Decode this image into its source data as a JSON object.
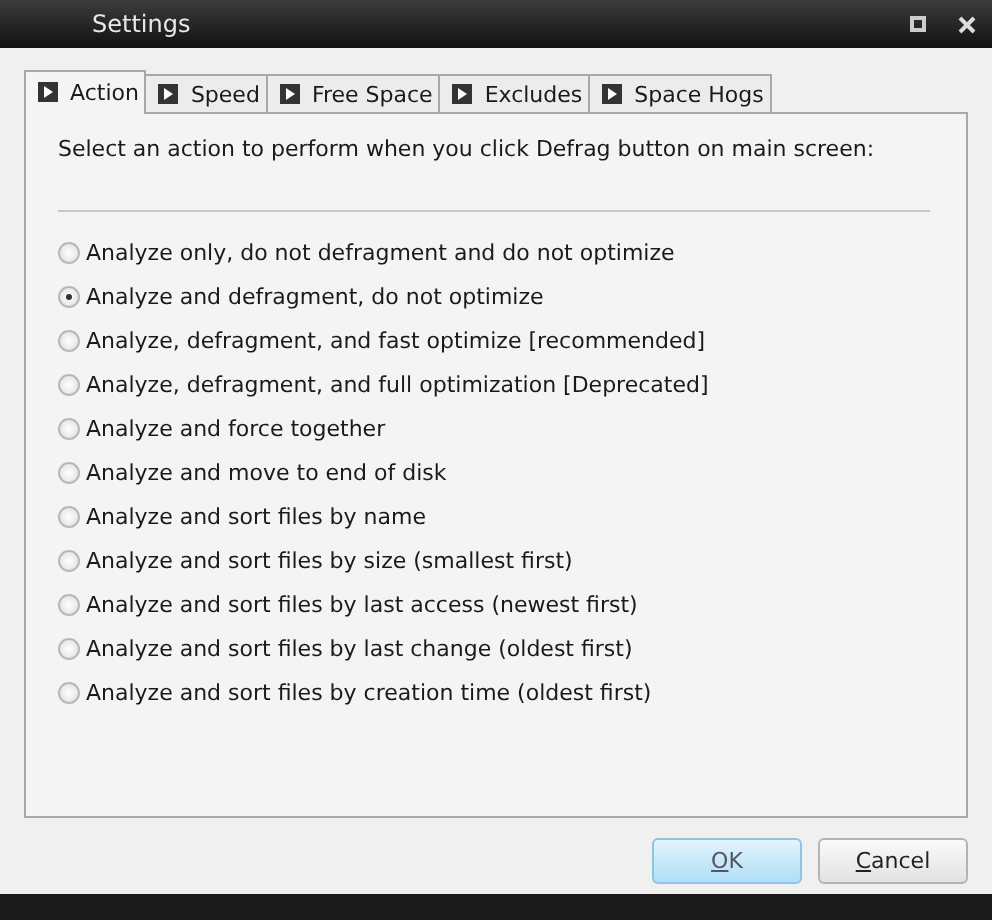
{
  "window": {
    "title": "Settings"
  },
  "tabs": [
    {
      "label": "Action",
      "selected": true
    },
    {
      "label": "Speed",
      "selected": false
    },
    {
      "label": "Free Space",
      "selected": false
    },
    {
      "label": "Excludes",
      "selected": false
    },
    {
      "label": "Space Hogs",
      "selected": false
    }
  ],
  "instruction": "Select an action to perform when you click Defrag button on main screen:",
  "options": [
    {
      "label": "Analyze only, do not defragment and do not optimize",
      "selected": false
    },
    {
      "label": "Analyze and defragment, do not optimize",
      "selected": true
    },
    {
      "label": "Analyze, defragment, and fast optimize [recommended]",
      "selected": false
    },
    {
      "label": "Analyze, defragment, and full optimization [Deprecated]",
      "selected": false
    },
    {
      "label": "Analyze and force together",
      "selected": false
    },
    {
      "label": "Analyze and move to end of disk",
      "selected": false
    },
    {
      "label": "Analyze and sort files by name",
      "selected": false
    },
    {
      "label": "Analyze and sort files by size (smallest first)",
      "selected": false
    },
    {
      "label": "Analyze and sort files by last access (newest first)",
      "selected": false
    },
    {
      "label": "Analyze and sort files by last change (oldest first)",
      "selected": false
    },
    {
      "label": "Analyze and sort files by creation time (oldest first)",
      "selected": false
    }
  ],
  "buttons": [
    {
      "label": "OK",
      "default": true
    },
    {
      "label": "Cancel",
      "default": false
    }
  ]
}
